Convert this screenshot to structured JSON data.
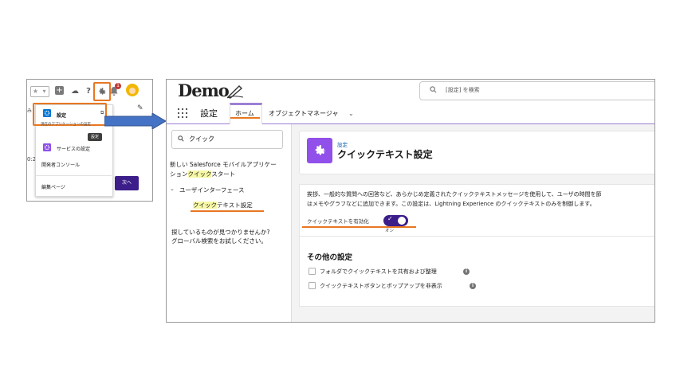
{
  "inset": {
    "menu": {
      "setup_label": "設定",
      "setup_desc": "現在のアプリケーションの設定",
      "tooltip": "設定",
      "service_setup_label": "サービスの設定",
      "developer_console_label": "開発者コンソール",
      "edit_page_label": "編集ページ"
    },
    "notification_count": "1",
    "next_button": "次へ",
    "bg_text_left": "み",
    "bg_time": "0:2",
    "help_glyph": "?"
  },
  "main": {
    "logo": "Demo",
    "search_placeholder": "[設定] を検索",
    "app_name": "設定",
    "tabs": {
      "home": "ホーム",
      "object_manager": "オブジェクトマネージャ"
    },
    "sidebar": {
      "quick_find_value": "クイック",
      "item1_pre": "新しい Salesforce モバイルアプリケー",
      "item1_line2_pre": "ション",
      "item1_highlight": "クイック",
      "item1_post": "スタート",
      "group_label": "ユーザインターフェース",
      "item2_highlight": "クイック",
      "item2_post": "テキスト設定",
      "not_found_line1": "探しているものが見つかりませんか?",
      "not_found_line2": "グローバル検索をお試しください。"
    },
    "page": {
      "breadcrumb": "設定",
      "title": "クイックテキスト設定"
    },
    "card": {
      "desc_line1": "挨拶、一般的な質問への回答など、あらかじめ定義されたクイックテキストメッセージを使用して、ユーザの時間を節",
      "desc_line2": "はメモやグラフなどに追加できます。この設定は、Lightning Experience のクイックテキストのみを制御します。",
      "toggle_label": "クイックテキストを有効化",
      "toggle_state": "オン",
      "other_settings_title": "その他の設定",
      "checkbox1": "フォルダでクイックテキストを共有および整理",
      "checkbox2": "クイックテキストボタンとポップアップを非表示"
    }
  },
  "colors": {
    "highlight_orange": "#e87722",
    "setup_purple": "#9050e9",
    "toggle_on": "#3c1d8a",
    "arrow_blue": "#4472c4"
  }
}
